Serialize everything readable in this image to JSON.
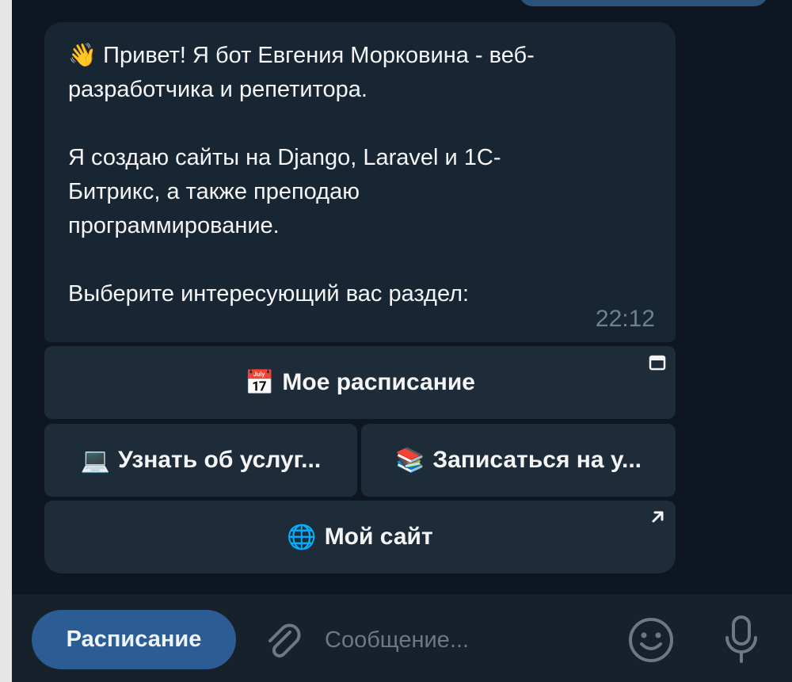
{
  "chat": {
    "message": {
      "greeting_emoji": "👋",
      "line1": " Привет! Я бот Евгения Морковина - веб-",
      "line2": "разработчика и репетитора.",
      "line3": "Я создаю сайты на Django, Laravel и 1С-",
      "line4": "Битрикс, а также преподаю",
      "line5": "программирование.",
      "line6": "Выберите интересующий вас раздел:",
      "time": "22:12"
    },
    "keyboard": {
      "row1": {
        "emoji": "📅",
        "label": "Мое расписание",
        "corner_icon": "window-icon"
      },
      "row2": [
        {
          "emoji": "💻",
          "label": "Узнать об услуг..."
        },
        {
          "emoji": "📚",
          "label": "Записаться на у..."
        }
      ],
      "row3": {
        "emoji": "🌐",
        "label": "Мой сайт",
        "corner_icon": "external-link-icon"
      }
    }
  },
  "composer": {
    "reply_button_label": "Расписание",
    "input_placeholder": "Сообщение...",
    "input_value": ""
  },
  "colors": {
    "background": "#0e1621",
    "bubble": "#182533",
    "button": "#1e2c3a",
    "reply_chip": "#2b5d94",
    "outgoing": "#2b5278"
  }
}
